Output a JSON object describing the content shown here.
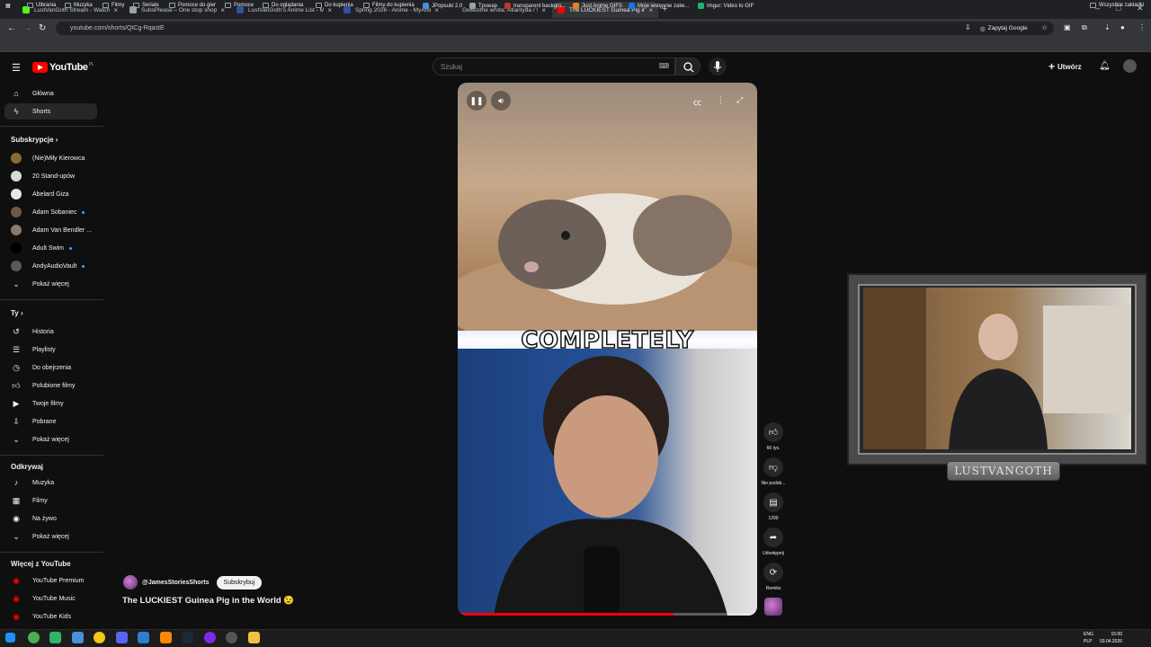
{
  "browser": {
    "tabs": [
      {
        "title": "LustVanGoth Stream - Watch Li",
        "color": "#53fc18",
        "active": false
      },
      {
        "title": "SubsPlease – One stop shop fo",
        "color": "#9aa0a6",
        "active": false
      },
      {
        "title": "LustVanGoth's Anime List - My",
        "color": "#2e51a2",
        "active": false
      },
      {
        "title": "Spring 2026 - Anime - MyAnim",
        "color": "#2e51a2",
        "active": false
      },
      {
        "title": "Gwiezdne wrota: Atlantyda / Sh",
        "color": "#202124",
        "active": false
      },
      {
        "title": "The LUCKIEST Guinea Pig in",
        "color": "#ff0000",
        "active": true
      }
    ],
    "url": "youtube.com/shorts/QtCg-RqastE",
    "zapytaj_label": "Zapytaj Google",
    "bookmarks": [
      {
        "label": "Ulbrania",
        "type": "folder"
      },
      {
        "label": "Muzyka",
        "type": "folder"
      },
      {
        "label": "Filmy",
        "type": "folder"
      },
      {
        "label": "Seriale",
        "type": "folder"
      },
      {
        "label": "Pomoce do gier",
        "type": "folder"
      },
      {
        "label": "Pomoce",
        "type": "folder"
      },
      {
        "label": "Do oglądania",
        "type": "folder"
      },
      {
        "label": "Do kupienia",
        "type": "folder"
      },
      {
        "label": "Filmy do kupienia",
        "type": "folder"
      },
      {
        "label": "JPopsuki 2.0",
        "type": "site",
        "color": "#4a90d9"
      },
      {
        "label": "Tpswap",
        "type": "site",
        "color": "#9aa0a6"
      },
      {
        "label": "transparent backgro...",
        "type": "site",
        "color": "#c0392b"
      },
      {
        "label": "Just Anime GIFS",
        "type": "site",
        "color": "#e67e22"
      },
      {
        "label": "Moje wstępnie zatw...",
        "type": "site",
        "color": "#1a73e8"
      },
      {
        "label": "Imgur: Video to GIF",
        "type": "site",
        "color": "#1bb76e"
      }
    ],
    "all_bookmarks": "Wszystkie zakładki"
  },
  "youtube": {
    "logo_text": "YouTube",
    "logo_country": "PL",
    "search_placeholder": "Szukaj",
    "create_label": "Utwórz",
    "nav": [
      {
        "label": "Główna",
        "icon": "home-icon"
      },
      {
        "label": "Shorts",
        "icon": "shorts-icon",
        "active": true
      }
    ],
    "subs_heading": "Subskrypcje",
    "subscriptions": [
      {
        "label": "(Nie)Miły Kierowca",
        "color": "#8a6a3a",
        "dot": false
      },
      {
        "label": "20 Stand-upów",
        "color": "#d9d9d9",
        "dot": false
      },
      {
        "label": "Abelard Giza",
        "color": "#e8e8e8",
        "dot": false
      },
      {
        "label": "Adam Sobaniec",
        "color": "#6b5a4a",
        "dot": true
      },
      {
        "label": "Adam Van Bendler ...",
        "color": "#8a7a6a",
        "dot": false
      },
      {
        "label": "Adult Swim",
        "color": "#000000",
        "dot": true
      },
      {
        "label": "AndyAudioVault",
        "color": "#5a5a5a",
        "dot": true
      }
    ],
    "show_more": "Pokaż więcej",
    "you_heading": "Ty",
    "you_items": [
      {
        "label": "Historia",
        "icon": "history-icon"
      },
      {
        "label": "Playlisty",
        "icon": "playlists-icon"
      },
      {
        "label": "Do obejrzenia",
        "icon": "watch-later-icon"
      },
      {
        "label": "Polubione filmy",
        "icon": "liked-icon"
      },
      {
        "label": "Twoje filmy",
        "icon": "your-videos-icon"
      },
      {
        "label": "Pobrane",
        "icon": "downloads-icon"
      },
      {
        "label": "Pokaż więcej",
        "icon": "chevron-down-icon"
      }
    ],
    "explore_heading": "Odkrywaj",
    "explore_items": [
      {
        "label": "Muzyka",
        "icon": "music-icon"
      },
      {
        "label": "Filmy",
        "icon": "movies-icon"
      },
      {
        "label": "Na żywo",
        "icon": "live-icon"
      },
      {
        "label": "Pokaż więcej",
        "icon": "chevron-down-icon"
      }
    ],
    "more_heading": "Więcej z YouTube",
    "more_items": [
      {
        "label": "YouTube Premium"
      },
      {
        "label": "YouTube Music"
      },
      {
        "label": "YouTube Kids"
      }
    ],
    "short": {
      "caption": "COMPLETELY",
      "progress": 0.72,
      "channel": "@JamesStoriesShorts",
      "subscribe_label": "Subskrybuj",
      "title": "The LUCKIEST Guinea Pig in the World 😉",
      "likes": "66 tys.",
      "dislike_label": "Nie podob...",
      "comments": "1299",
      "share_label": "Udostępnij",
      "remix_label": "Remiks"
    }
  },
  "overlay": {
    "name_plate": "LUSTVANGOTH"
  },
  "taskbar": {
    "lang": "ENG",
    "lang2": "PLP",
    "time": "15:00",
    "date": "03.04.2026"
  }
}
